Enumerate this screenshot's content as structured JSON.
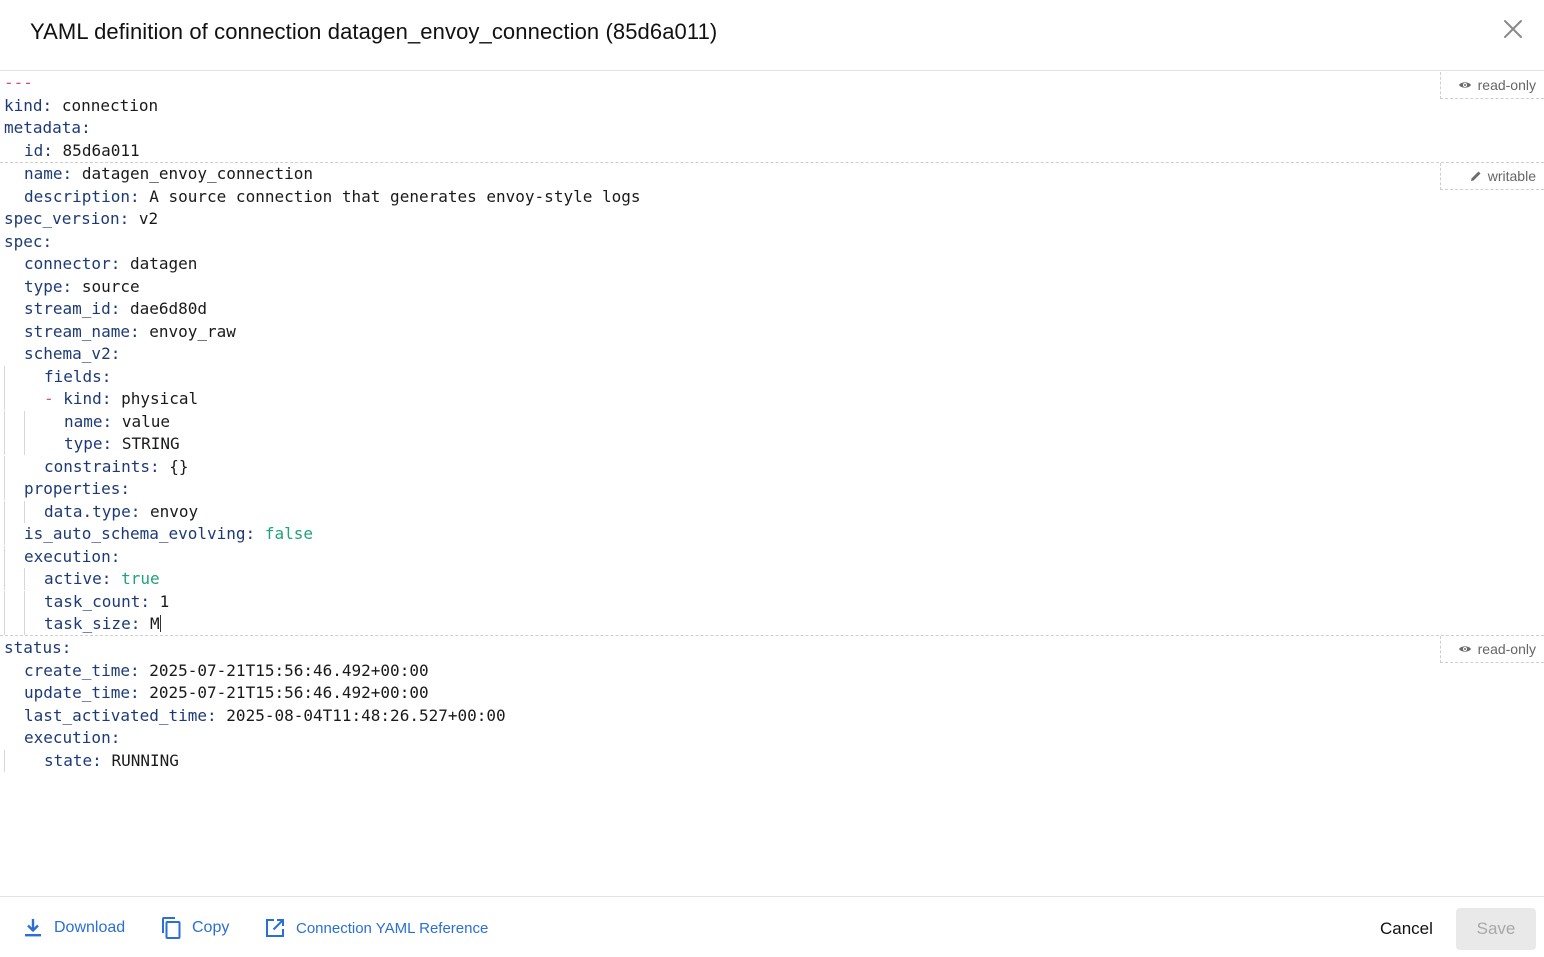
{
  "dialog": {
    "title": "YAML definition of connection datagen_envoy_connection (85d6a011)"
  },
  "sections": {
    "read_only_label": "read-only",
    "writable_label": "writable"
  },
  "yaml": {
    "doc_start": "---",
    "kind_key": "kind:",
    "kind_val": "connection",
    "metadata_key": "metadata:",
    "id_key": "id:",
    "id_val": "85d6a011",
    "name_key": "name:",
    "name_val": "datagen_envoy_connection",
    "description_key": "description:",
    "description_val": "A source connection that generates envoy-style logs",
    "spec_version_key": "spec_version:",
    "spec_version_val": "v2",
    "spec_key": "spec:",
    "connector_key": "connector:",
    "connector_val": "datagen",
    "type_key": "type:",
    "type_val": "source",
    "stream_id_key": "stream_id:",
    "stream_id_val": "dae6d80d",
    "stream_name_key": "stream_name:",
    "stream_name_val": "envoy_raw",
    "schema_v2_key": "schema_v2:",
    "fields_key": "fields:",
    "field_dash": "-",
    "field_kind_key": "kind:",
    "field_kind_val": "physical",
    "field_name_key": "name:",
    "field_name_val": "value",
    "field_type_key": "type:",
    "field_type_val": "STRING",
    "constraints_key": "constraints:",
    "constraints_val": "{}",
    "properties_key": "properties:",
    "data_type_key": "data.type:",
    "data_type_val": "envoy",
    "auto_schema_key": "is_auto_schema_evolving:",
    "auto_schema_val": "false",
    "execution_key": "execution:",
    "active_key": "active:",
    "active_val": "true",
    "task_count_key": "task_count:",
    "task_count_val": "1",
    "task_size_key": "task_size:",
    "task_size_val": "M",
    "status_key": "status:",
    "create_time_key": "create_time:",
    "create_time_val": "2025-07-21T15:56:46.492+00:00",
    "update_time_key": "update_time:",
    "update_time_val": "2025-07-21T15:56:46.492+00:00",
    "last_activated_key": "last_activated_time:",
    "last_activated_val": "2025-08-04T11:48:26.527+00:00",
    "status_execution_key": "execution:",
    "state_key": "state:",
    "state_val": "RUNNING"
  },
  "footer": {
    "download_label": "Download",
    "copy_label": "Copy",
    "reference_label": "Connection YAML Reference",
    "cancel_label": "Cancel",
    "save_label": "Save"
  },
  "colors": {
    "link": "#2a6fd6",
    "yaml_key": "#1d3a78",
    "yaml_bool": "#1fa37c",
    "yaml_doc_marker": "#d94d78"
  },
  "icons": [
    "close-icon",
    "eye-icon",
    "pencil-icon",
    "download-icon",
    "copy-icon",
    "external-link-icon"
  ]
}
